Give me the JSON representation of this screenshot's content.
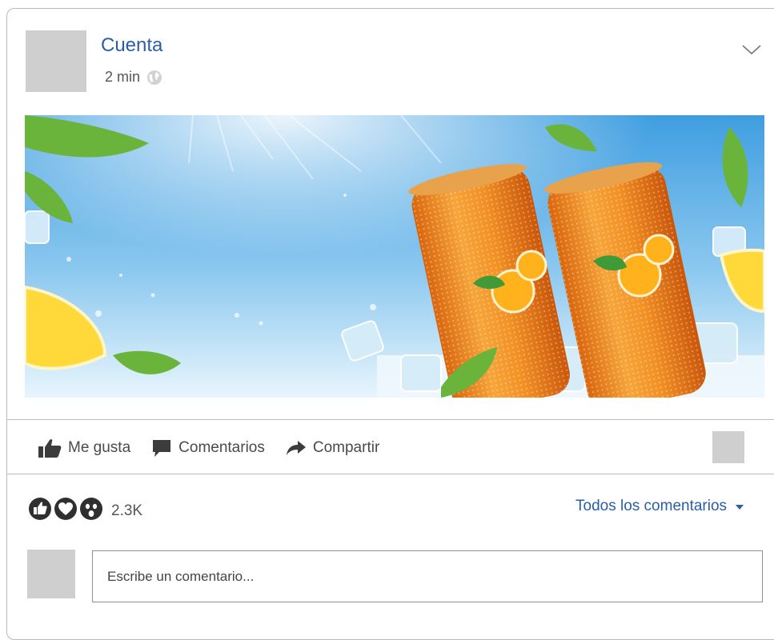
{
  "post": {
    "account_name": "Cuenta",
    "time": "2 min",
    "icons": {
      "privacy": "globe-icon",
      "menu": "chevron-down-icon"
    }
  },
  "image": {
    "description_icon": "post-image",
    "sky_color": "#6fb7e6",
    "can_color": "#f08a1c"
  },
  "actions": {
    "like_label": "Me gusta",
    "comment_label": "Comentarios",
    "share_label": "Compartir"
  },
  "reactions": {
    "icons": [
      "like-icon",
      "heart-icon",
      "wow-icon"
    ],
    "count": "2.3K"
  },
  "comments": {
    "filter_label": "Todos los comentarios",
    "input_placeholder": "Escribe un comentario..."
  },
  "colors": {
    "link": "#2a5ea8",
    "icon": "#3c3c3c",
    "placeholder_box": "#cfcfcf",
    "border": "#b9b9b9"
  }
}
